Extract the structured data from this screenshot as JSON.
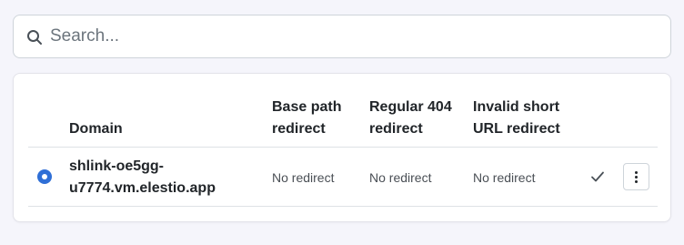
{
  "search": {
    "placeholder": "Search...",
    "value": ""
  },
  "table": {
    "headers": {
      "domain": "Domain",
      "base_path_redirect": [
        "Base path",
        "redirect"
      ],
      "regular_404_redirect": [
        "Regular 404",
        "redirect"
      ],
      "invalid_short_url_redirect": [
        "Invalid short",
        "URL redirect"
      ]
    },
    "rows": [
      {
        "is_default": true,
        "domain": [
          "shlink-oe5gg-",
          "u7774.vm.elestio.app"
        ],
        "base_path_redirect": "No redirect",
        "regular_404_redirect": "No redirect",
        "invalid_short_url_redirect": "No redirect",
        "status_icon": "check-icon",
        "actions_icon": "kebab-menu-icon"
      }
    ]
  },
  "colors": {
    "accent": "#2f6fd6",
    "background": "#f5f5fb",
    "card": "#ffffff",
    "border": "#ced4da"
  }
}
